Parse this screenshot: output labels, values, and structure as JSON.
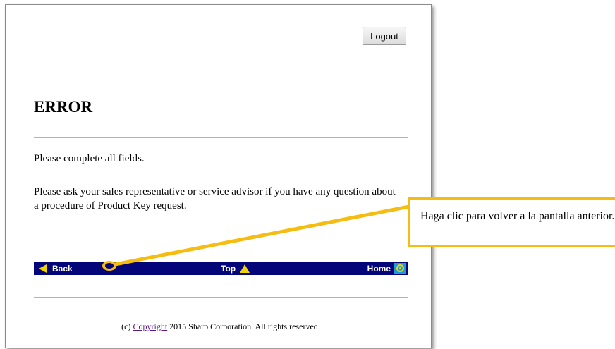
{
  "header": {
    "logout_label": "Logout"
  },
  "main": {
    "title": "ERROR",
    "message_1": "Please complete all fields.",
    "message_2": "Please ask your sales representative or service advisor if you have any question about a procedure of Product Key request."
  },
  "nav": {
    "back_label": "Back",
    "top_label": "Top",
    "home_label": "Home",
    "bar_color": "#05057a",
    "icon_color": "#f2d300"
  },
  "footer": {
    "prefix": "(c) ",
    "link_text": "Copyright",
    "suffix": " 2015 Sharp Corporation. All rights reserved."
  },
  "annotation": {
    "text": "Haga clic para volver a la pantalla anterior.",
    "color": "#f5bd12"
  }
}
